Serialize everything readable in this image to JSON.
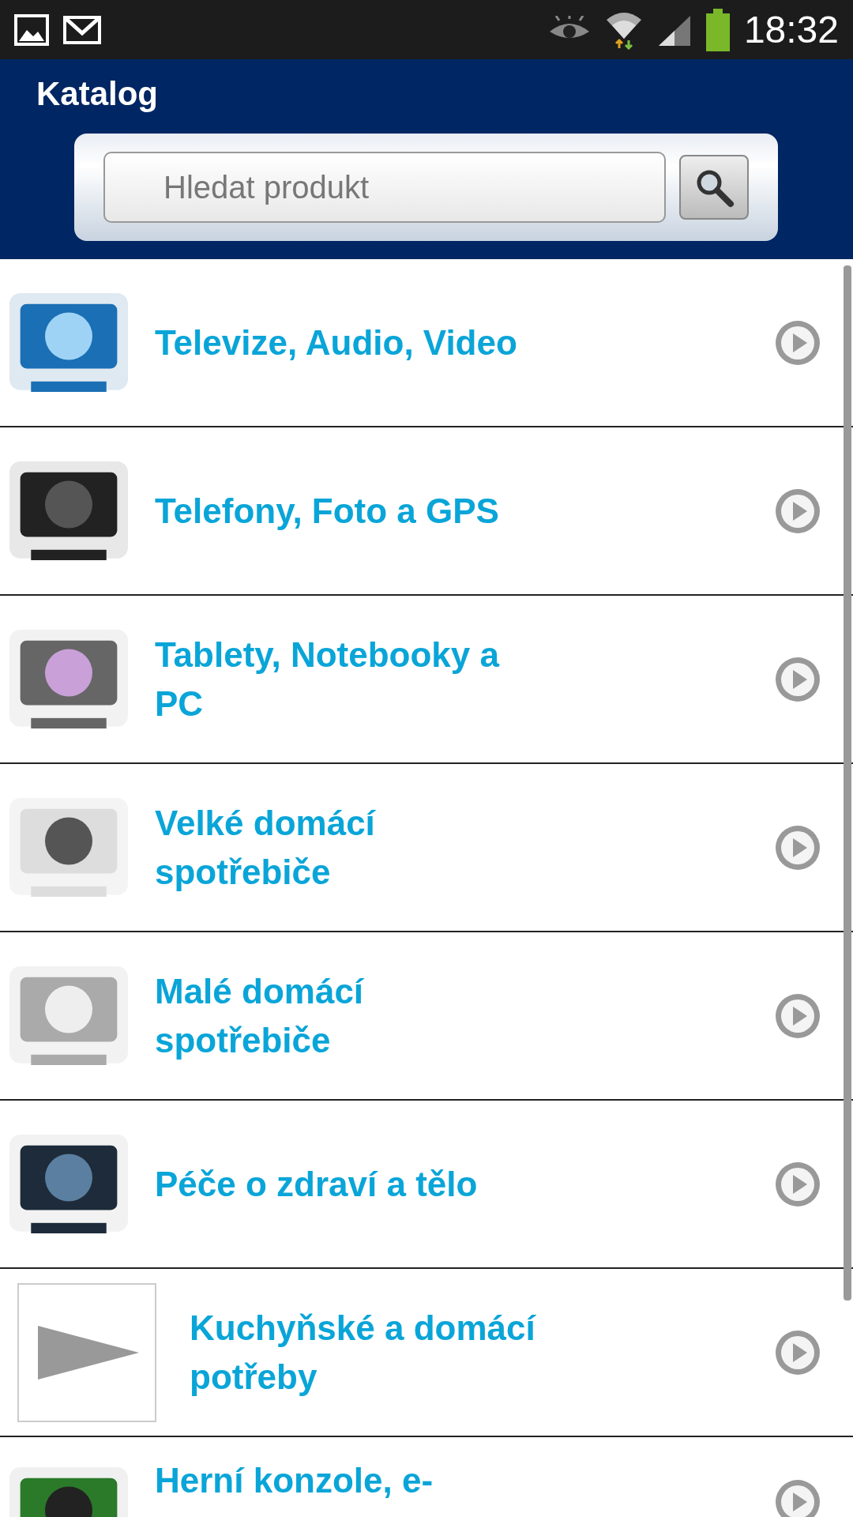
{
  "status_bar": {
    "time": "18:32"
  },
  "header": {
    "title": "Katalog"
  },
  "search": {
    "placeholder": "Hledat produkt"
  },
  "categories": [
    {
      "label": "Televize, Audio, Video",
      "kind": "picture"
    },
    {
      "label": "Telefony, Foto a GPS",
      "kind": "picture"
    },
    {
      "label": "Tablety, Notebooky a PC",
      "kind": "picture"
    },
    {
      "label": "Velké domácí spotřebiče",
      "kind": "picture"
    },
    {
      "label": "Malé domácí spotřebiče",
      "kind": "picture"
    },
    {
      "label": "Péče o zdraví a tělo",
      "kind": "picture"
    },
    {
      "label": "Kuchyňské a domácí potřeby",
      "kind": "placeholder"
    },
    {
      "label": "Herní konzole, e-",
      "kind": "picture"
    }
  ]
}
